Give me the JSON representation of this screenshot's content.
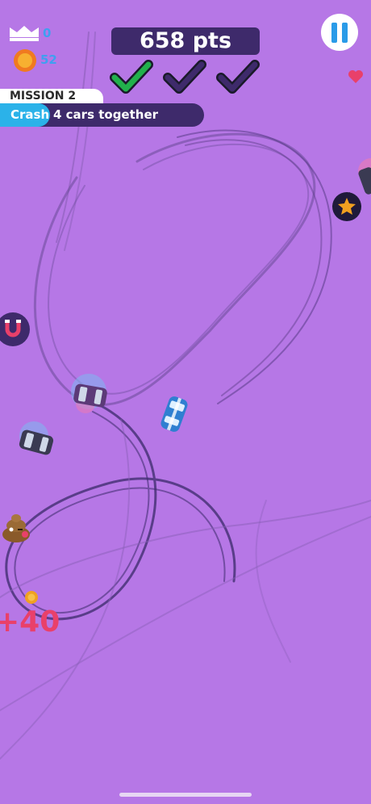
{
  "hud": {
    "best_score": "0",
    "coins": "52",
    "score": "658 pts",
    "crown_icon": "crown-icon",
    "coin_icon": "coin-icon",
    "pause_icon": "pause-icon",
    "heart_icon": "heart-icon",
    "lives": 1,
    "checks": [
      {
        "state": "complete",
        "color": "#22b14c"
      },
      {
        "state": "pending",
        "color": "#3e2a6b"
      },
      {
        "state": "pending",
        "color": "#3e2a6b"
      }
    ]
  },
  "mission": {
    "title": "MISSION 2",
    "verb": "Crash",
    "text": "4 cars together",
    "progress": 0.25
  },
  "floating_bonus": "+40",
  "colors": {
    "background": "#b677e6",
    "hud_panel": "#3e2a6b",
    "accent_blue": "#2bb2e9",
    "check_green": "#22b14c",
    "bonus_red": "#e9406a"
  },
  "objects": [
    {
      "kind": "player-car",
      "color": "#2f7fd1"
    },
    {
      "kind": "police-car",
      "color": "#5c3a78"
    },
    {
      "kind": "police-car",
      "color": "#3a3a52"
    },
    {
      "kind": "magnet-powerup-icon"
    },
    {
      "kind": "police-badge-icon"
    },
    {
      "kind": "poop-emoji-icon"
    },
    {
      "kind": "coin-icon"
    }
  ]
}
